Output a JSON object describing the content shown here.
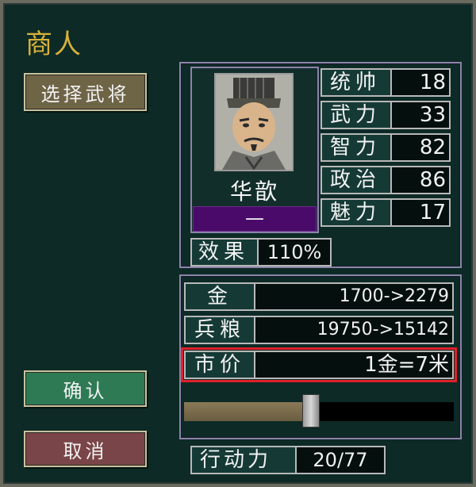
{
  "title": "商人",
  "buttons": {
    "select_general": "选择武将",
    "confirm": "确认",
    "cancel": "取消"
  },
  "general": {
    "name": "华歆",
    "tag": "—",
    "stats": [
      {
        "label": "统帅",
        "value": "18"
      },
      {
        "label": "武力",
        "value": "33"
      },
      {
        "label": "智力",
        "value": "82"
      },
      {
        "label": "政治",
        "value": "86"
      },
      {
        "label": "魅力",
        "value": "17"
      }
    ],
    "effect": {
      "label": "效果",
      "value": "110%"
    }
  },
  "trade": {
    "gold": {
      "label": "金",
      "value": "1700->2279"
    },
    "food": {
      "label": "兵粮",
      "value": "19750->15142"
    },
    "price": {
      "label": "市价",
      "value": "1金=7米"
    }
  },
  "slider": {
    "fraction": 0.47
  },
  "action_points": {
    "label": "行动力",
    "value": "20/77"
  },
  "colors": {
    "background": "#0d2a26",
    "title": "#d8b23a",
    "highlight": "#e0202a",
    "tag_bar": "#4a0a6a"
  }
}
